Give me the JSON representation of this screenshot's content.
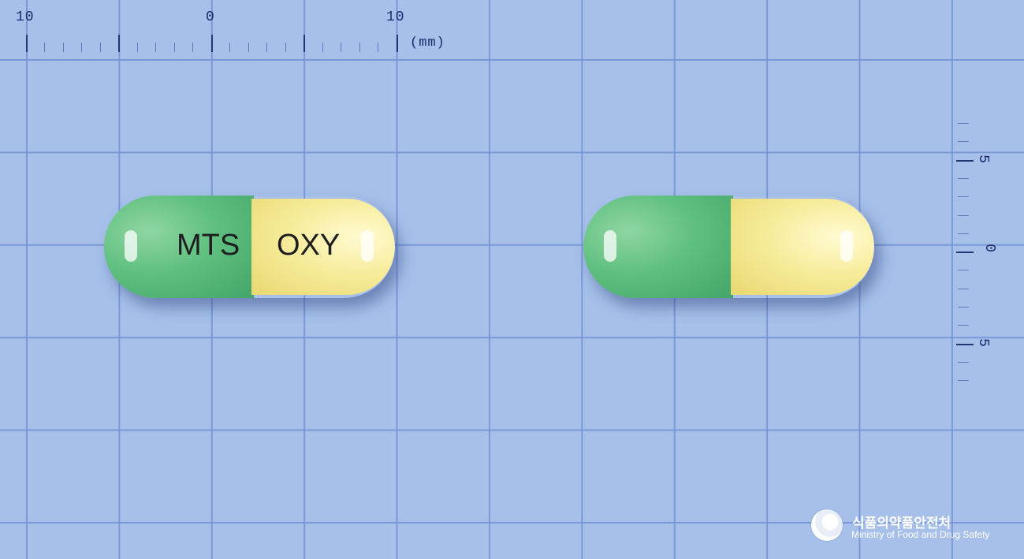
{
  "ruler_top": {
    "labels": [
      "10",
      "0",
      "10"
    ],
    "unit": "(mm)"
  },
  "ruler_right": {
    "labels": [
      "5",
      "0",
      "5"
    ]
  },
  "pill_front": {
    "imprint_left": "MTS",
    "imprint_right": "OXY",
    "colors": {
      "left_cap": "#5fbf80",
      "right_cap": "#f7ec9c"
    }
  },
  "pill_back": {
    "colors": {
      "left_cap": "#5fbf80",
      "right_cap": "#f7ec9c"
    }
  },
  "logo": {
    "korean": "식품의약품안전처",
    "english": "Ministry of Food and Drug Safety"
  }
}
